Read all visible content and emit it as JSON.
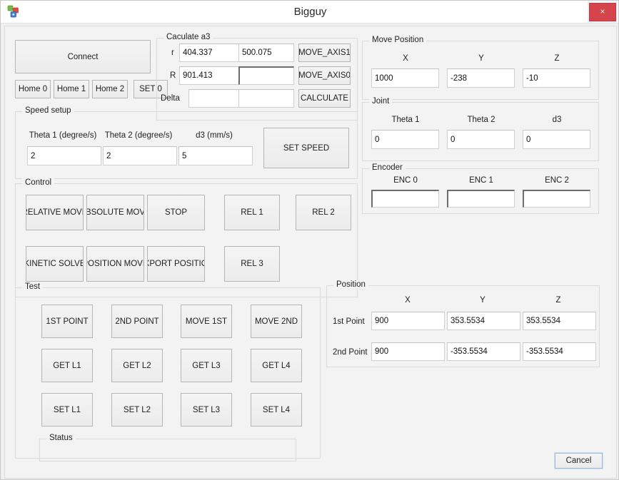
{
  "window": {
    "title": "Bigguy",
    "close_label": "×",
    "icon": "blocks-icon"
  },
  "connect": {
    "connect_label": "Connect",
    "home_buttons": [
      "Home 0",
      "Home 1",
      "Home 2",
      "SET 0"
    ]
  },
  "calculate_a3": {
    "legend": "Caculate a3",
    "rows": [
      {
        "label": "r",
        "value_a": "404.337",
        "value_b": "500.075",
        "button": "MOVE_AXIS1"
      },
      {
        "label": "R",
        "value_a": "901.413",
        "value_b": "",
        "button": "MOVE_AXIS0"
      },
      {
        "label": "Delta",
        "value_a": "",
        "value_b": "",
        "button": "CALCULATE"
      }
    ]
  },
  "speed_setup": {
    "legend": "Speed setup",
    "fields": [
      {
        "label": "Theta 1 (degree/s)",
        "value": "2"
      },
      {
        "label": "Theta 2 (degree/s)",
        "value": "2"
      },
      {
        "label": "d3 (mm/s)",
        "value": "5"
      }
    ],
    "set_speed_label": "SET SPEED"
  },
  "control": {
    "legend": "Control",
    "row1": [
      "RELATIVE MOVE",
      "ABSOLUTE MOVE",
      "STOP"
    ],
    "row2": [
      "KINETIC SOLVE",
      "POSITION MOVE",
      "EXPORT POSITION"
    ],
    "rel1": "REL 1",
    "rel2": "REL 2",
    "rel3": "REL 3"
  },
  "test": {
    "legend": "Test",
    "row1": [
      "1ST POINT",
      "2ND POINT",
      "MOVE  1ST",
      "MOVE  2ND"
    ],
    "row2": [
      "GET L1",
      "GET L2",
      "GET L3",
      "GET L4"
    ],
    "row3": [
      "SET L1",
      "SET L2",
      "SET L3",
      "SET L4"
    ]
  },
  "status": {
    "legend": "Status",
    "text": ""
  },
  "move_position": {
    "legend": "Move Position",
    "headers": [
      "X",
      "Y",
      "Z"
    ],
    "values": [
      "1000",
      "-238",
      "-10"
    ]
  },
  "joint": {
    "legend": "Joint",
    "headers": [
      "Theta 1",
      "Theta 2",
      "d3"
    ],
    "values": [
      "0",
      "0",
      "0"
    ]
  },
  "encoder": {
    "legend": "Encoder",
    "headers": [
      "ENC 0",
      "ENC 1",
      "ENC 2"
    ],
    "values": [
      "",
      "",
      ""
    ]
  },
  "position": {
    "legend": "Position",
    "headers": [
      "X",
      "Y",
      "Z"
    ],
    "rows": [
      {
        "label": "1st Point",
        "x": "900",
        "y": "353.5534",
        "z": "353.5534"
      },
      {
        "label": "2nd Point",
        "x": "900",
        "y": "-353.5534",
        "z": "-353.5534"
      }
    ]
  },
  "footer": {
    "cancel_label": "Cancel"
  },
  "colors": {
    "close_red": "#d4444a",
    "window_bg": "#f3f3f3",
    "group_border": "#dadada",
    "focus_blue": "#9fb9d8"
  }
}
